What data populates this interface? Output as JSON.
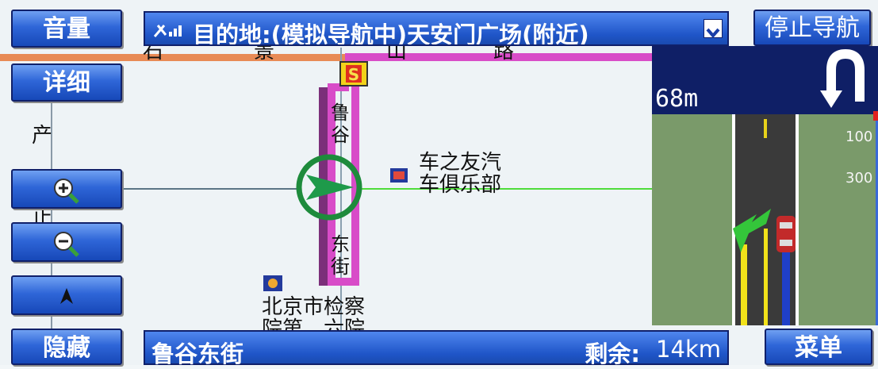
{
  "top_bar": {
    "destination_label": "目的地:(模拟导航中)天安门广场(附近)"
  },
  "buttons": {
    "volume": "音量",
    "detail": "详细",
    "hide": "隐藏",
    "stop_navigation": "停止导航",
    "menu": "菜单"
  },
  "status": {
    "current_road": "鲁谷东街",
    "remaining_label": "剩余:",
    "remaining_value": "14km"
  },
  "map": {
    "labels": {
      "partial_left_1": "产",
      "partial_left_2": "止",
      "road_vertical_1": "鲁",
      "road_vertical_2": "谷",
      "road_vertical_3": "东",
      "road_vertical_4": "街",
      "road_top_1": "石",
      "road_top_2": "景",
      "road_top_3": "山",
      "road_top_4": "路",
      "poi_club_line1": "车之友汽",
      "poi_club_line2": "车俱乐部",
      "poi_procuratorate_line1": "北京市检察",
      "poi_procuratorate_line2": "院第　六院"
    },
    "start_marker": "S"
  },
  "guidance": {
    "distance": "68m",
    "maneuver_icon": "u-turn-icon",
    "scale_marks": [
      "100",
      "300"
    ]
  },
  "colors": {
    "route": "#d84cc8",
    "button_blue": "#2f66d8",
    "current_position": "#1e8b3c",
    "guidance_header": "#0f1f66"
  }
}
